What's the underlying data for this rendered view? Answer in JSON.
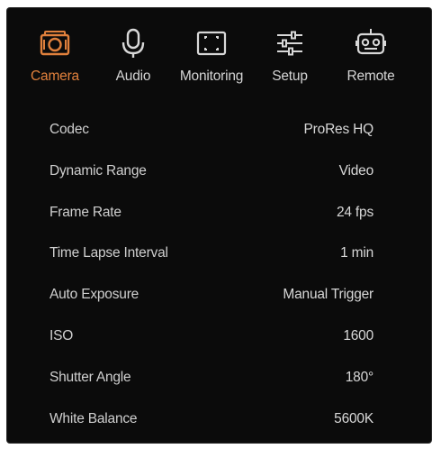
{
  "tabs": [
    {
      "label": "Camera",
      "icon": "camera-icon",
      "active": true
    },
    {
      "label": "Audio",
      "icon": "microphone-icon",
      "active": false
    },
    {
      "label": "Monitoring",
      "icon": "monitor-frame-icon",
      "active": false
    },
    {
      "label": "Setup",
      "icon": "sliders-icon",
      "active": false
    },
    {
      "label": "Remote",
      "icon": "remote-robot-icon",
      "active": false
    }
  ],
  "settings": [
    {
      "label": "Codec",
      "value": "ProRes HQ"
    },
    {
      "label": "Dynamic Range",
      "value": "Video"
    },
    {
      "label": "Frame Rate",
      "value": "24 fps"
    },
    {
      "label": "Time Lapse Interval",
      "value": "1 min"
    },
    {
      "label": "Auto Exposure",
      "value": "Manual Trigger"
    },
    {
      "label": "ISO",
      "value": "1600"
    },
    {
      "label": "Shutter Angle",
      "value": "180°"
    },
    {
      "label": "White Balance",
      "value": "5600K"
    }
  ],
  "colors": {
    "accent": "#e0803c",
    "panel_bg": "#0b0b0b",
    "text": "#d4d4d4"
  }
}
